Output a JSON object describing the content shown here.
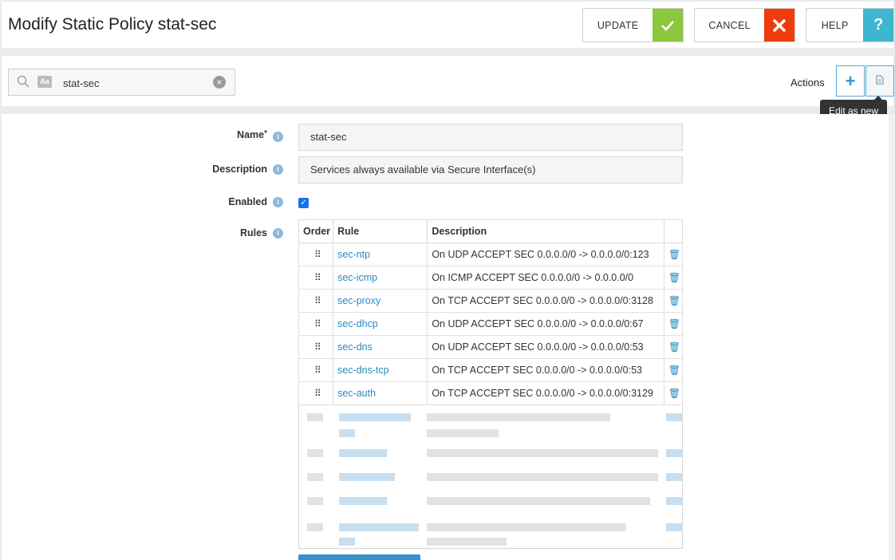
{
  "header": {
    "title": "Modify Static Policy stat-sec",
    "update_label": "UPDATE",
    "cancel_label": "CANCEL",
    "help_label": "HELP",
    "update_icon": "check-icon",
    "cancel_icon": "close-icon",
    "help_icon": "question-icon",
    "colors": {
      "update": "#8dc63f",
      "cancel": "#f03c0c",
      "help": "#3fb6cf"
    }
  },
  "toolbar": {
    "search_value": "stat-sec",
    "case_toggle": "Aa",
    "actions_label": "Actions",
    "tooltip": "Edit as new"
  },
  "form": {
    "name_label": "Name",
    "name_required": "*",
    "name_value": "stat-sec",
    "description_label": "Description",
    "description_value": "Services always available via Secure Interface(s)",
    "enabled_label": "Enabled",
    "enabled": true,
    "rules_label": "Rules"
  },
  "rules_table": {
    "headers": [
      "Order",
      "Rule",
      "Description",
      ""
    ],
    "rows": [
      {
        "rule": "sec-ntp",
        "description": "On UDP ACCEPT SEC 0.0.0.0/0 -> 0.0.0.0/0:123"
      },
      {
        "rule": "sec-icmp",
        "description": "On ICMP ACCEPT SEC 0.0.0.0/0 -> 0.0.0.0/0"
      },
      {
        "rule": "sec-proxy",
        "description": "On TCP ACCEPT SEC 0.0.0.0/0 -> 0.0.0.0/0:3128"
      },
      {
        "rule": "sec-dhcp",
        "description": "On UDP ACCEPT SEC 0.0.0.0/0 -> 0.0.0.0/0:67"
      },
      {
        "rule": "sec-dns",
        "description": "On UDP ACCEPT SEC 0.0.0.0/0 -> 0.0.0.0/0:53"
      },
      {
        "rule": "sec-dns-tcp",
        "description": "On TCP ACCEPT SEC 0.0.0.0/0 -> 0.0.0.0/0:53"
      },
      {
        "rule": "sec-auth",
        "description": "On TCP ACCEPT SEC 0.0.0.0/0 -> 0.0.0.0/0:3129"
      }
    ]
  }
}
